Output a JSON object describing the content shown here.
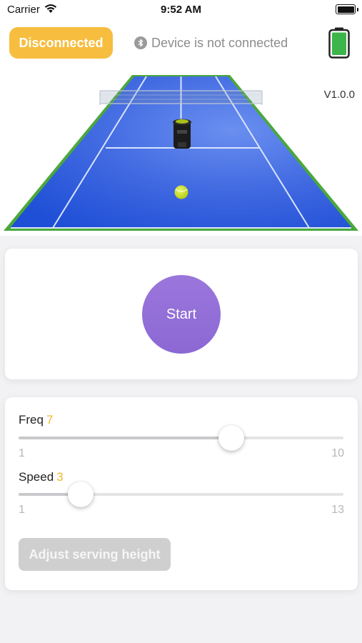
{
  "status_bar": {
    "carrier": "Carrier",
    "time": "9:52 AM"
  },
  "connection": {
    "badge_label": "Disconnected",
    "badge_color": "#f6bd3e",
    "bluetooth_text": "Device is not connected"
  },
  "device": {
    "battery_color": "#3cb54a"
  },
  "version": "V1.0.0",
  "court": {
    "surface_color": "#2f5ee0",
    "border_color": "#4aa83a"
  },
  "start": {
    "label": "Start",
    "color": "#9370db"
  },
  "controls": {
    "freq": {
      "label": "Freq",
      "value": "7",
      "min": "1",
      "max": "10"
    },
    "speed": {
      "label": "Speed",
      "value": "3",
      "min": "1",
      "max": "13"
    },
    "adjust_label": "Adjust serving height"
  }
}
